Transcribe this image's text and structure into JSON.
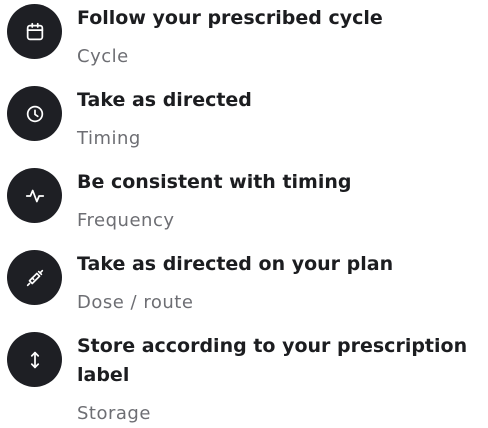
{
  "items": [
    {
      "title": "Follow your prescribed cycle",
      "subtitle": "Cycle",
      "icon": "calendar-icon"
    },
    {
      "title": "Take as directed",
      "subtitle": "Timing",
      "icon": "clock-icon"
    },
    {
      "title": "Be consistent with timing",
      "subtitle": "Frequency",
      "icon": "pulse-icon"
    },
    {
      "title": "Take as directed on your plan",
      "subtitle": "Dose / route",
      "icon": "syringe-icon"
    },
    {
      "title": "Store according to your prescription label",
      "subtitle": "Storage",
      "icon": "vertical-arrows-icon"
    }
  ],
  "colors": {
    "icon_background": "#1e1f24",
    "icon_foreground": "#ffffff",
    "title_text": "#1c1d20",
    "subtitle_text": "#6d6e73"
  }
}
